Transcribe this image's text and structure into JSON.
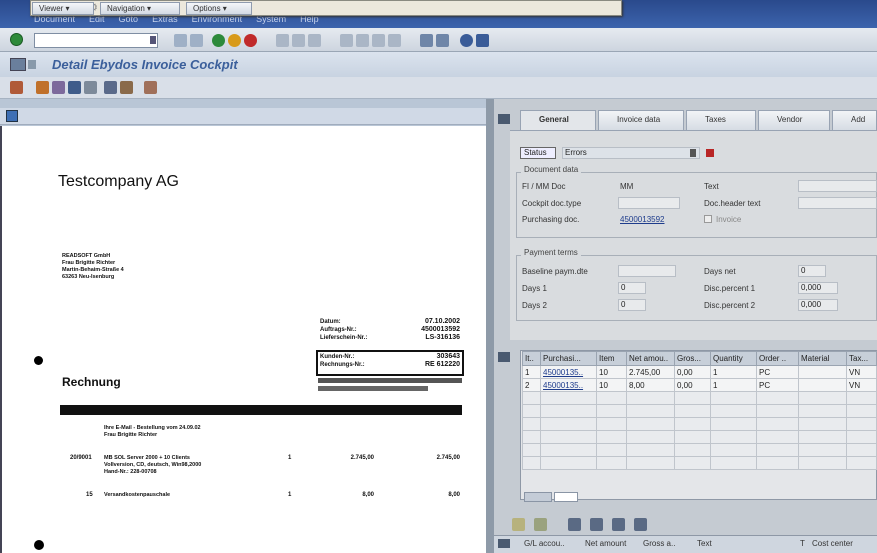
{
  "menu": [
    "Document",
    "Edit",
    "Goto",
    "Extras",
    "Environment",
    "System",
    "Help"
  ],
  "window": {
    "title": "Detail Ebydos Invoice Cockpit"
  },
  "left_toolbar": {
    "viewer": "Viewer",
    "navigation": "Navigation",
    "options": "Options"
  },
  "document": {
    "company": "Testcompany AG",
    "sender_lines": [
      "READSOFT GmbH",
      "Frau Brigitte Richter",
      "Martin-Behaim-Straße 4",
      "",
      "63263 Neu-Isenburg"
    ],
    "meta_labels": [
      "Datum:",
      "Auftrags-Nr.:",
      "Lieferschein-Nr.:"
    ],
    "meta_values": [
      "07.10.2002",
      "4500013592",
      "LS-316136"
    ],
    "box_labels": [
      "Kunden-Nr.:",
      "Rechnungs-Nr.:"
    ],
    "box_values": [
      "303643",
      "RE 612220"
    ],
    "title": "Rechnung",
    "order_text": "Ihre E-Mail - Bestellung vom 24.09.02",
    "order_text2": "Frau Brigitte Richter",
    "item1_no": "20/9001",
    "item1_desc": "MB SOL Server 2000 + 10 Clients",
    "item1_desc2": "Vollversion, CD, deutsch, Win98,2000",
    "item1_desc3": "Hand-Nr.: 228-00708",
    "item1_qty": "1",
    "item1_price": "2.745,00",
    "item1_total": "2.745,00",
    "item2_no": "15",
    "item2_desc": "Versandkostenpauschale",
    "item2_qty": "1",
    "item2_price": "8,00",
    "item2_total": "8,00"
  },
  "tabs": [
    "General",
    "Invoice data",
    "Taxes",
    "Vendor",
    "Add"
  ],
  "status": {
    "label": "Status",
    "value": "Errors"
  },
  "document_data": {
    "title": "Document data",
    "fi_mm_doc": "FI / MM Doc",
    "fi_mm_value": "MM",
    "cockpit_doc_type": "Cockpit doc.type",
    "purchasing_doc": "Purchasing doc.",
    "purchasing_value": "4500013592",
    "text": "Text",
    "doc_header_text": "Doc.header text",
    "invoice_checkbox": "Invoice"
  },
  "payment_terms": {
    "title": "Payment terms",
    "baseline": "Baseline paym.dte",
    "days1": "Days 1",
    "days1_value": "0",
    "days2": "Days 2",
    "days2_value": "0",
    "days_net": "Days net",
    "days_net_value": "0",
    "disc1": "Disc.percent 1",
    "disc1_value": "0,000",
    "disc2": "Disc.percent 2",
    "disc2_value": "0,000"
  },
  "table": {
    "headers": [
      "It..",
      "Purchasi...",
      "Item",
      "Net amou..",
      "Gros...",
      "Quantity",
      "Order ..",
      "Material",
      "Tax..."
    ],
    "rows": [
      [
        "1",
        "45000135..",
        "10",
        "2.745,00",
        "0,00",
        "1",
        "PC",
        "",
        "VN"
      ],
      [
        "2",
        "45000135..",
        "10",
        "8,00",
        "0,00",
        "1",
        "PC",
        "",
        "VN"
      ]
    ]
  },
  "bottom_table": {
    "headers": [
      "G/L accou..",
      "Net amount",
      "Gross a..",
      "Text",
      "T",
      "Cost center"
    ]
  }
}
